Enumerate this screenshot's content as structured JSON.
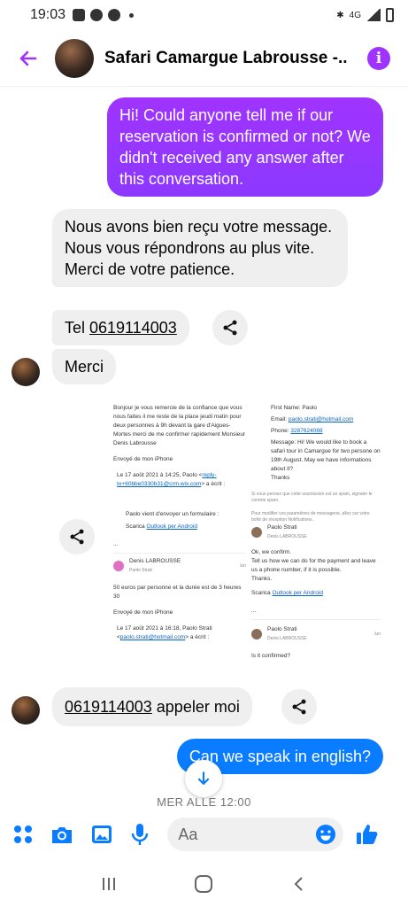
{
  "status": {
    "time": "19:03",
    "net_label": "4G"
  },
  "header": {
    "title": "Safari Camargue Labrousse -...",
    "info_icon": "i"
  },
  "messages": {
    "out1": "Hi! Could anyone tell me if our reservation is confirmed or not? We didn't received any answer after this conversation.",
    "in1": "Nous avons bien reçu votre message. Nous vous répondrons au plus vite. Merci de votre patience.",
    "in2_prefix": "Tel ",
    "in2_phone": "0619114003",
    "in3": "Merci",
    "in4_phone": "0619114003",
    "in4_suffix": " appeler moi",
    "out2": "Can we speak in english?"
  },
  "screenshot": {
    "left": {
      "p1": "Bonjour je vous remercie de la confiance que vous nous faites il me reste de la place jeudi matin pour deux personnes à 9h devant la gare d'Aigues-Mortes merci de me confirmer rapidement Monsieur Denis Labrousse",
      "p2": "Envoyé de mon iPhone",
      "p3_prefix": "Le 17 août 2021 à 14:25, Paolo <",
      "p3_link": "reply-to+60bbe0330b31@crm.wix.com",
      "p3_suffix": "> a écrit :",
      "p4": "Paolo vient d'envoyer un formulaire :",
      "p5_prefix": "Scarica ",
      "p5_link": "Outlook per Android",
      "ellipsis": "...",
      "card_name": "Denis LABROUSSE",
      "card_to": "Paolo Strati",
      "card_time": "lun",
      "p6": "50 euros par personne et la durée est de 3 heures 30",
      "p7": "Envoyé de mon iPhone",
      "p8_prefix": "Le 17 août 2021 à 16:18, Paolo Strati <",
      "p8_link": "paolo.strati@hotmail.com",
      "p8_suffix": "> a écrit :"
    },
    "right": {
      "first_name": "First Name: Paolo",
      "email_label": "Email: ",
      "email": "paolo.strati@hotmail.com",
      "phone_label": "Phone: ",
      "phone": "3287624088",
      "message": "Message: Hi! We would like to book a safari tour in Camargue for two persone on 19th August. May we have informations about it?",
      "thanks": "Thanks",
      "note1": "Si vous pensez que cette soumission est un spam, signaler le comme spam.",
      "note2": "Pour modifier vos paramètres de messagerie, allez sur votre boîte de réception Notifications.",
      "card1_name": "Paolo Strati",
      "card1_to": "Denis LABROUSSE",
      "reply1": "Ok, we confirm.",
      "reply2": "Tell us how we can do for the payment and leave us a phone number, if it is possible.",
      "reply3": "Thanks.",
      "outlook_prefix": "Scarica ",
      "outlook_link": "Outlook per Android",
      "ellipsis": "...",
      "card2_name": "Paolo Strati",
      "card2_to": "Denis LABROUSSE",
      "card_time": "lun",
      "final": "Is it confirmed?"
    }
  },
  "day_label": "MER ALLE 12:00",
  "composer": {
    "placeholder": "Aa"
  },
  "colors": {
    "accent": "#a033ff",
    "blue": "#0a7cff",
    "bubble_in": "#efefef"
  },
  "icons": [
    "back-arrow-icon",
    "info-icon",
    "share-icon",
    "arrow-down-icon",
    "apps-icon",
    "camera-icon",
    "gallery-icon",
    "microphone-icon",
    "emoji-icon",
    "like-icon",
    "recent-apps-icon",
    "home-icon",
    "back-icon"
  ]
}
